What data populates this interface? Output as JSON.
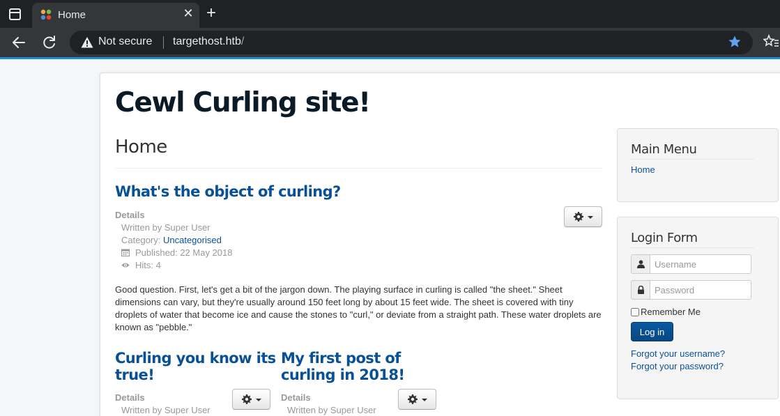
{
  "browser": {
    "tab_title": "Home",
    "security_label": "Not secure",
    "url_host": "targethost.htb",
    "url_path": "/"
  },
  "site": {
    "title": "Cewl Curling site!"
  },
  "page": {
    "heading": "Home"
  },
  "articles": [
    {
      "title": "What's the object of curling?",
      "details_label": "Details",
      "written_by": "Written by Super User",
      "category_prefix": "Category: ",
      "category": "Uncategorised",
      "published": "Published: 22 May 2018",
      "hits": "Hits: 4",
      "body": "Good question. First, let's get a bit of the jargon down. The playing surface in curling is called \"the sheet.\" Sheet dimensions can vary, but they're usually around 150 feet long by about 15 feet wide. The sheet is covered with tiny droplets of water that become ice and cause the stones to \"curl,\" or deviate from a straight path. These water droplets are known as \"pebble.\""
    },
    {
      "title_line1": "Curling you know its",
      "title_line2": "true!",
      "details_label": "Details",
      "written_by": "Written by Super User"
    },
    {
      "title_line1": "My first post of",
      "title_line2": "curling in 2018!",
      "details_label": "Details",
      "written_by": "Written by Super User"
    }
  ],
  "sidebar": {
    "main_menu": {
      "title": "Main Menu",
      "items": [
        "Home"
      ]
    },
    "login_form": {
      "title": "Login Form",
      "username_placeholder": "Username",
      "password_placeholder": "Password",
      "remember_label": "Remember Me",
      "login_button": "Log in",
      "forgot_username": "Forgot your username?",
      "forgot_password": "Forgot your password?"
    }
  },
  "colors": {
    "link": "#095197",
    "accent_bar": "#1b8fd1",
    "login_button": "#08467f"
  },
  "icons": [
    "tab-switcher-icon",
    "joomla-favicon",
    "close-icon",
    "new-tab-icon",
    "back-icon",
    "reload-icon",
    "warning-icon",
    "star-icon",
    "extensions-icon",
    "gear-icon",
    "user-icon",
    "lock-icon",
    "calendar-icon",
    "eye-icon"
  ]
}
